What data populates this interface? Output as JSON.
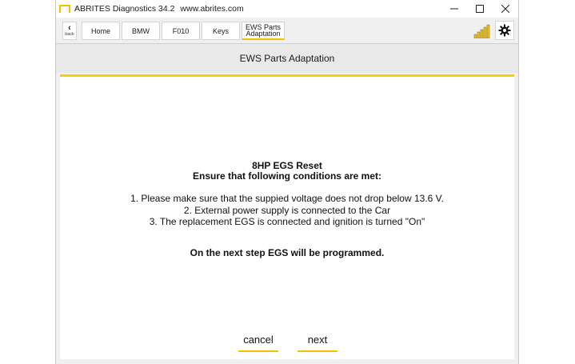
{
  "window": {
    "app_name": "ABRITES Diagnostics 34.2",
    "url": "www.abrites.com"
  },
  "toolbar": {
    "back_label": "back",
    "breadcrumbs": [
      "Home",
      "BMW",
      "F010",
      "Keys",
      "EWS Parts\nAdaptation"
    ]
  },
  "header": {
    "title": "EWS Parts Adaptation"
  },
  "dialog": {
    "title": "8HP EGS Reset",
    "subtitle": "Ensure that following conditions are met:",
    "conditions": [
      "1. Please make sure that the suppied voltage does not drop below 13.6 V.",
      "2. External power supply is connected to the Car",
      "3. The replacement EGS is connected and ignition is turned \"On\""
    ],
    "footer_note": "On the next step EGS will be programmed.",
    "cancel_label": "cancel",
    "next_label": "next"
  },
  "colors": {
    "accent": "#f2c200",
    "content_bg": "#ffffff",
    "chrome_bg": "#f0f0f0"
  },
  "icons": {
    "back": "chevron-left-icon",
    "signal": "signal-bars-icon",
    "settings": "gear-icon",
    "minimize": "minimize-icon",
    "maximize": "maximize-icon",
    "close": "close-icon"
  }
}
